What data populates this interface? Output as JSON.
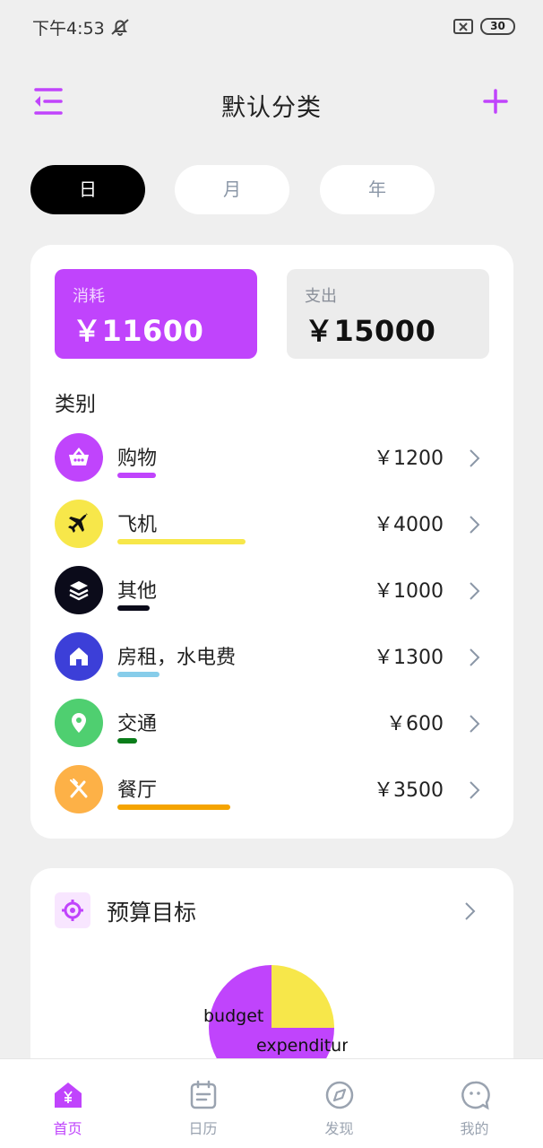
{
  "status_bar": {
    "time": "下午4:53",
    "battery": "30"
  },
  "header": {
    "title": "默认分类"
  },
  "tabs": [
    {
      "label": "日",
      "active": true
    },
    {
      "label": "月",
      "active": false
    },
    {
      "label": "年",
      "active": false
    }
  ],
  "summary": {
    "consume": {
      "label": "消耗",
      "value": "￥11600"
    },
    "expense": {
      "label": "支出",
      "value": "￥15000"
    }
  },
  "categories": {
    "title": "类别",
    "items": [
      {
        "name": "购物",
        "amount": "￥1200",
        "icon": "shopping-basket-icon",
        "color": "#c044fc",
        "bar_fraction": 0.3
      },
      {
        "name": "飞机",
        "amount": "￥4000",
        "icon": "airplane-icon",
        "color": "#f7e74a",
        "bar_fraction": 1.0
      },
      {
        "name": "其他",
        "amount": "￥1000",
        "icon": "layers-icon",
        "color": "#0b0b1a",
        "bar_fraction": 0.25
      },
      {
        "name": "房租，水电费",
        "amount": "￥1300",
        "icon": "home-icon",
        "color": "#3c3fd8",
        "bar_fraction": 0.33
      },
      {
        "name": "交通",
        "amount": "￥600",
        "icon": "location-pin-icon",
        "color": "#4fcf70",
        "bar_fraction": 0.15
      },
      {
        "name": "餐厅",
        "amount": "￥3500",
        "icon": "fork-knife-icon",
        "color": "#fdb147",
        "bar_fraction": 0.88
      }
    ],
    "bar_colors": [
      "#c044fc",
      "#f7e74a",
      "#0b0b1a",
      "#87cdea",
      "#0a7d1a",
      "#f5a400"
    ]
  },
  "budget": {
    "title": "预算目标",
    "pie": {
      "labels": [
        "budget",
        "expenditure"
      ],
      "values": [
        0.75,
        0.25
      ],
      "colors": [
        "#c044fc",
        "#f7e74a"
      ]
    },
    "pie_label_budget": "budget",
    "pie_label_expenditure": "expenditur"
  },
  "nav": [
    {
      "label": "首页",
      "icon": "home-yen-icon",
      "active": true
    },
    {
      "label": "日历",
      "icon": "calendar-icon",
      "active": false
    },
    {
      "label": "发现",
      "icon": "compass-icon",
      "active": false
    },
    {
      "label": "我的",
      "icon": "chat-face-icon",
      "active": false
    }
  ],
  "colors": {
    "accent": "#c044fc",
    "muted": "#9aa3b0"
  }
}
